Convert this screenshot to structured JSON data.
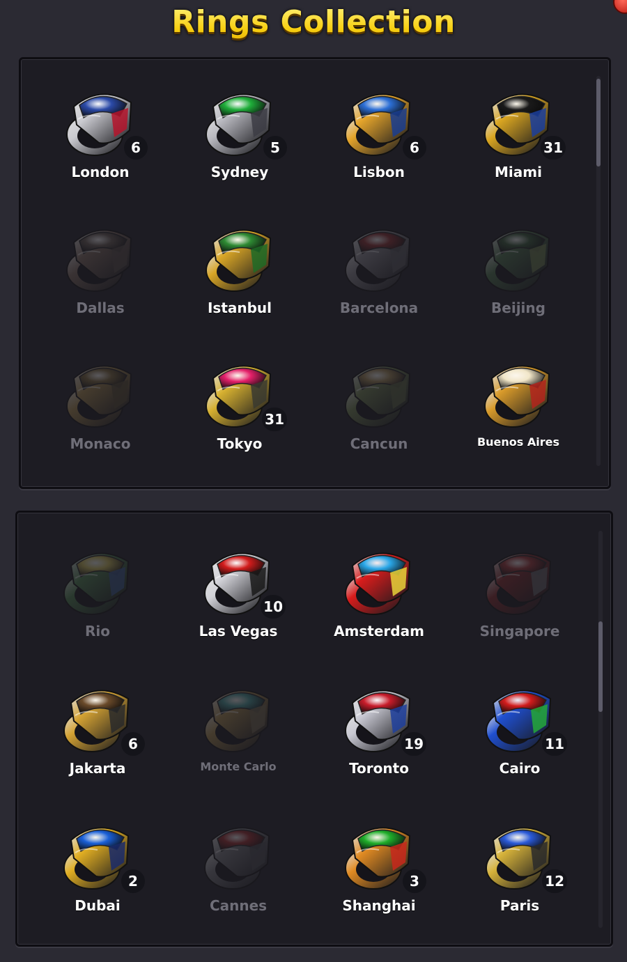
{
  "title": "Rings Collection",
  "close_icon": "close-icon",
  "panel1": {
    "rings": [
      {
        "name": "London",
        "count": "6",
        "locked": false,
        "band": "#c9c9cf",
        "gem": "#2b4aa8",
        "accent": "#b5142b"
      },
      {
        "name": "Sydney",
        "count": "5",
        "locked": false,
        "band": "#b8b8bf",
        "gem": "#1fae3a",
        "accent": "#3c3c44"
      },
      {
        "name": "Lisbon",
        "count": "6",
        "locked": false,
        "band": "#e4a42b",
        "gem": "#2c6fd6",
        "accent": "#1a3d8f"
      },
      {
        "name": "Miami",
        "count": "31",
        "locked": false,
        "band": "#d9a521",
        "gem": "#1a1a1a",
        "accent": "#1b3e9c"
      },
      {
        "name": "Dallas",
        "count": "",
        "locked": true,
        "band": "#8a6a55",
        "gem": "#6d5a4c",
        "accent": "#5a4a40"
      },
      {
        "name": "Istanbul",
        "count": "",
        "locked": false,
        "band": "#d8a526",
        "gem": "#2e8a33",
        "accent": "#1f6b26"
      },
      {
        "name": "Barcelona",
        "count": "",
        "locked": true,
        "band": "#8c8a92",
        "gem": "#b02222",
        "accent": "#5a5a60"
      },
      {
        "name": "Beijing",
        "count": "",
        "locked": true,
        "band": "#3f7a3c",
        "gem": "#2a5f2a",
        "accent": "#6b8a3a"
      },
      {
        "name": "Monaco",
        "count": "",
        "locked": true,
        "band": "#b88a2a",
        "gem": "#8a6a22",
        "accent": "#5a4a20"
      },
      {
        "name": "Tokyo",
        "count": "31",
        "locked": false,
        "band": "#d6b030",
        "gem": "#e5206a",
        "accent": "#3a3a30"
      },
      {
        "name": "Cancun",
        "count": "",
        "locked": true,
        "band": "#6e8a3a",
        "gem": "#b08a3a",
        "accent": "#5a6a30"
      },
      {
        "name": "Buenos Aires",
        "count": "",
        "locked": false,
        "band": "#d89a2a",
        "gem": "#f1e6c8",
        "accent": "#b2241c"
      }
    ]
  },
  "panel2": {
    "rings": [
      {
        "name": "Rio",
        "count": "",
        "locked": true,
        "band": "#3a8a3a",
        "gem": "#d9c22a",
        "accent": "#2a5ab0"
      },
      {
        "name": "Las Vegas",
        "count": "10",
        "locked": false,
        "band": "#d2d2d8",
        "gem": "#d21c1c",
        "accent": "#1a1a1a"
      },
      {
        "name": "Amsterdam",
        "count": "",
        "locked": false,
        "band": "#d81c1c",
        "gem": "#2aa7e8",
        "accent": "#e8d23a"
      },
      {
        "name": "Singapore",
        "count": "",
        "locked": true,
        "band": "#a81c1c",
        "gem": "#c82828",
        "accent": "#6a6a70"
      },
      {
        "name": "Jakarta",
        "count": "6",
        "locked": false,
        "band": "#d4a233",
        "gem": "#6a4a2a",
        "accent": "#2a2a2a"
      },
      {
        "name": "Monte Carlo",
        "count": "",
        "locked": true,
        "band": "#b88a2a",
        "gem": "#2aa7a0",
        "accent": "#7a6a40"
      },
      {
        "name": "Toronto",
        "count": "19",
        "locked": false,
        "band": "#c8c8d2",
        "gem": "#c81c2a",
        "accent": "#1f3f9c"
      },
      {
        "name": "Cairo",
        "count": "11",
        "locked": false,
        "band": "#1f4fd0",
        "gem": "#d21c1c",
        "accent": "#24a83a"
      },
      {
        "name": "Dubai",
        "count": "2",
        "locked": false,
        "band": "#e0ad22",
        "gem": "#1a60d8",
        "accent": "#1a2a6a"
      },
      {
        "name": "Cannes",
        "count": "",
        "locked": true,
        "band": "#7a7a80",
        "gem": "#c81c1c",
        "accent": "#4a4a50"
      },
      {
        "name": "Shanghai",
        "count": "3",
        "locked": false,
        "band": "#e08a22",
        "gem": "#1fae2a",
        "accent": "#c8281c"
      },
      {
        "name": "Paris",
        "count": "12",
        "locked": false,
        "band": "#d6b23a",
        "gem": "#2a5ad8",
        "accent": "#2a2a2a"
      }
    ]
  }
}
